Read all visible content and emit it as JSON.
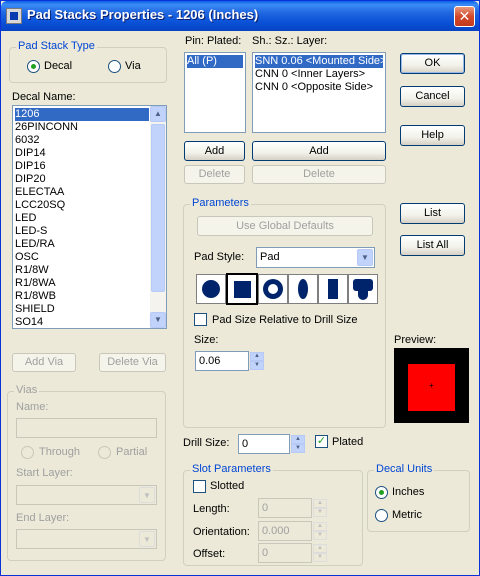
{
  "window": {
    "title": "Pad Stacks Properties - 1206 (Inches)"
  },
  "pad_stack_type": {
    "group_label": "Pad Stack Type",
    "options": [
      "Decal",
      "Via"
    ],
    "selected": "Decal"
  },
  "decal_name": {
    "label": "Decal Name:",
    "items": [
      "1206",
      "26PINCONN",
      "6032",
      "DIP14",
      "DIP16",
      "DIP20",
      "ELECTAA",
      "LCC20SQ",
      "LED",
      "LED-S",
      "LED/RA",
      "OSC",
      "R1/8W",
      "R1/8WA",
      "R1/8WB",
      "SHIELD",
      "SO14"
    ],
    "selected": "1206"
  },
  "add_via_label": "Add Via",
  "delete_via_label": "Delete Via",
  "vias": {
    "group_label": "Vias",
    "name_label": "Name:",
    "through_label": "Through",
    "partial_label": "Partial",
    "start_layer_label": "Start Layer:",
    "end_layer_label": "End Layer:"
  },
  "pin_header": "Pin:  Plated:",
  "pin_items": [
    "All (P)"
  ],
  "layer_header": "Sh.:  Sz.:  Layer:",
  "layer_items": [
    "SNN 0.06 <Mounted Side>",
    "CNN 0 <Inner Layers>",
    "CNN 0 <Opposite Side>"
  ],
  "pin_add": "Add",
  "pin_delete": "Delete",
  "layer_add": "Add",
  "layer_delete": "Delete",
  "buttons": {
    "ok": "OK",
    "cancel": "Cancel",
    "help": "Help",
    "list": "List",
    "list_all": "List All"
  },
  "parameters": {
    "group_label": "Parameters",
    "use_global": "Use Global Defaults",
    "pad_style_label": "Pad Style:",
    "pad_style_value": "Pad",
    "shape_icons": [
      "round-pad-icon",
      "square-pad-icon",
      "annular-pad-icon",
      "oval-pad-icon",
      "rectangle-pad-icon",
      "thermal-pad-icon"
    ],
    "relative_label": "Pad Size Relative to Drill Size",
    "size_label": "Size:",
    "size_value": "0.06"
  },
  "preview_label": "Preview:",
  "drill_size": {
    "label": "Drill Size:",
    "value": "0",
    "plated_label": "Plated",
    "plated": true
  },
  "slot_parameters": {
    "group_label": "Slot Parameters",
    "slotted_label": "Slotted",
    "length_label": "Length:",
    "length_value": "0",
    "orientation_label": "Orientation:",
    "orientation_value": "0.000",
    "offset_label": "Offset:",
    "offset_value": "0"
  },
  "decal_units": {
    "group_label": "Decal Units",
    "options": [
      "Inches",
      "Metric"
    ],
    "selected": "Inches"
  },
  "colors": {
    "preview_bg": "#000000",
    "preview_pad": "#ff0000",
    "accent": "#316ac5"
  }
}
